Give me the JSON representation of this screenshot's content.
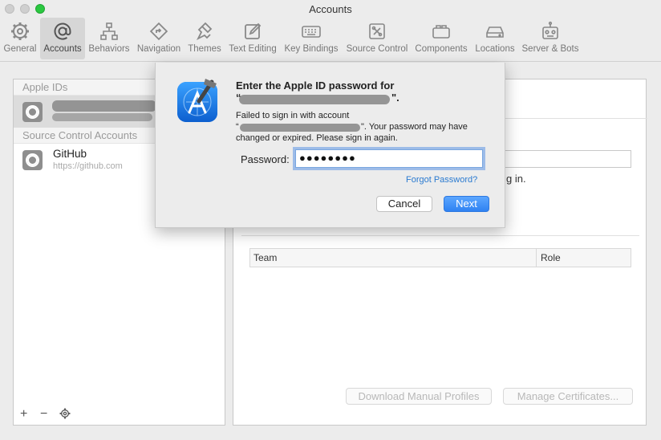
{
  "window": {
    "title": "Accounts"
  },
  "toolbar": {
    "items": [
      {
        "label": "General",
        "icon": "gear-icon"
      },
      {
        "label": "Accounts",
        "icon": "at-sign-icon",
        "active": true
      },
      {
        "label": "Behaviors",
        "icon": "behaviors-icon"
      },
      {
        "label": "Navigation",
        "icon": "navigation-icon"
      },
      {
        "label": "Themes",
        "icon": "brush-icon"
      },
      {
        "label": "Text Editing",
        "icon": "pencil-icon"
      },
      {
        "label": "Key Bindings",
        "icon": "keyboard-icon"
      },
      {
        "label": "Source Control",
        "icon": "source-control-icon"
      },
      {
        "label": "Components",
        "icon": "components-icon"
      },
      {
        "label": "Locations",
        "icon": "drive-icon"
      },
      {
        "label": "Server & Bots",
        "icon": "robot-icon"
      }
    ]
  },
  "sidebar": {
    "apple_ids_header": "Apple IDs",
    "source_control_header": "Source Control Accounts",
    "github": {
      "name": "GitHub",
      "url": "https://github.com"
    }
  },
  "detail": {
    "hint_text": "g in.",
    "team_header": "Team",
    "role_header": "Role",
    "download_profiles_label": "Download Manual Profiles",
    "manage_certificates_label": "Manage Certificates..."
  },
  "dialog": {
    "title_prefix": "Enter the Apple ID password for",
    "title_line2_suffix": "\".",
    "body_line1": "Failed to sign in with account",
    "body_line2_suffix": "\". Your password may have",
    "body_line3": "changed or expired. Please sign in again.",
    "password_label": "Password:",
    "password_value": "●●●●●●●●",
    "forgot_label": "Forgot Password?",
    "cancel_label": "Cancel",
    "next_label": "Next"
  },
  "colors": {
    "accent": "#2f82f2",
    "link": "#2a7ad0",
    "focus_ring": "#5c96e6"
  }
}
